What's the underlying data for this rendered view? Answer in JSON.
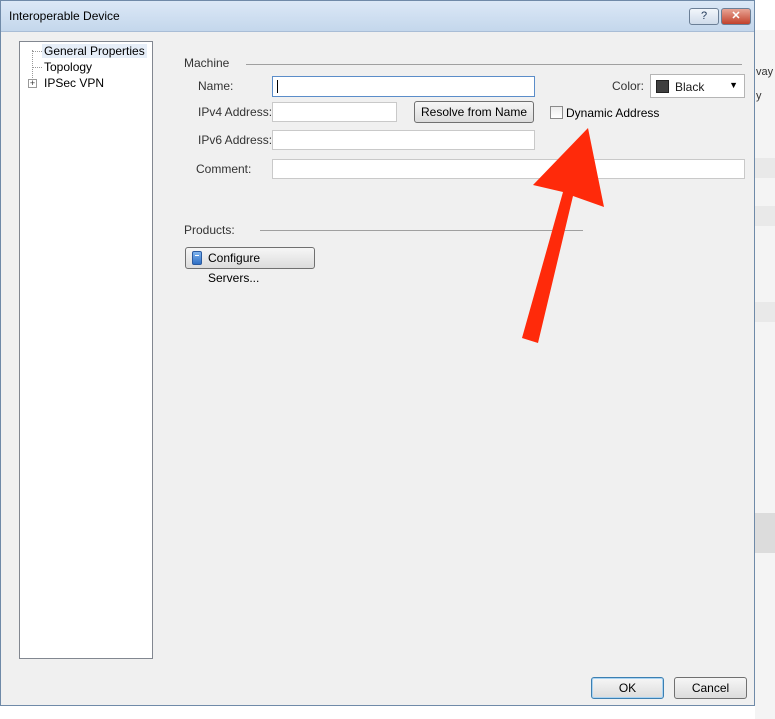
{
  "window": {
    "title": "Interoperable Device",
    "help_label": "?",
    "close_label": "✕"
  },
  "tree": {
    "items": [
      {
        "label": "General Properties",
        "selected": true
      },
      {
        "label": "Topology",
        "selected": false
      },
      {
        "label": "IPSec VPN",
        "selected": false,
        "expandable": true
      }
    ],
    "expander_label": "+"
  },
  "machine": {
    "section_label": "Machine",
    "name_label": "Name:",
    "name_value": "",
    "ipv4_label": "IPv4 Address:",
    "ipv4_value": "",
    "resolve_button": "Resolve from Name",
    "ipv6_label": "IPv6 Address:",
    "ipv6_value": "",
    "comment_label": "Comment:",
    "comment_value": "",
    "color_label": "Color:",
    "color_value": "Black",
    "color_swatch": "#404040",
    "dynamic_address_label": "Dynamic Address",
    "dynamic_address_checked": false
  },
  "products": {
    "section_label": "Products:",
    "configure_servers_button": "Configure Servers...",
    "configure_icon": "server-icon"
  },
  "footer": {
    "ok_label": "OK",
    "cancel_label": "Cancel"
  },
  "background_window": {
    "fragments": [
      "vay",
      "y"
    ]
  },
  "annotation": {
    "arrow_color": "#ff2a0a",
    "arrow_target": "dynamic-address-checkbox"
  }
}
